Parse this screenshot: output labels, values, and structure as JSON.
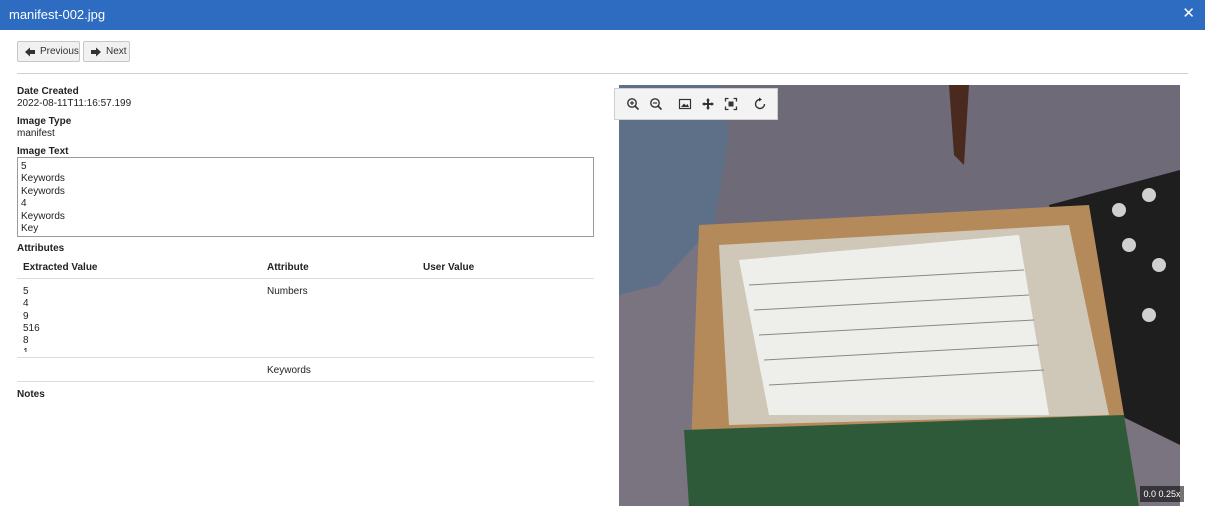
{
  "window": {
    "title": "manifest-002.jpg"
  },
  "nav": {
    "previous_label": "Previous",
    "next_label": "Next"
  },
  "fields": {
    "date_created_label": "Date Created",
    "date_created_value": "2022-08-11T11:16:57.199",
    "image_type_label": "Image Type",
    "image_type_value": "manifest",
    "image_text_label": "Image Text",
    "image_text_lines": [
      "5",
      "Keywords",
      "Keywords",
      "4",
      "Keywords",
      "Key"
    ]
  },
  "attributes": {
    "section_label": "Attributes",
    "columns": [
      "Extracted Value",
      "Attribute",
      "User Value"
    ],
    "rows": [
      {
        "extracted": [
          "5",
          "4",
          "9",
          "516",
          "8",
          "1"
        ],
        "attribute": "Numbers",
        "user_value": ""
      },
      {
        "extracted": [],
        "attribute": "Keywords",
        "user_value": ""
      }
    ]
  },
  "notes": {
    "label": "Notes"
  },
  "viewer": {
    "toolbar_icons": [
      "zoom-in-icon",
      "zoom-out-icon",
      "image-icon",
      "move-icon",
      "fit-screen-icon",
      "rotate-icon"
    ],
    "zoom_readout": "0.0 0.25x"
  }
}
